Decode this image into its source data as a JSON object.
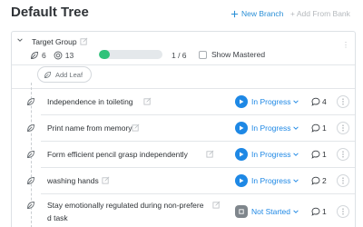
{
  "header": {
    "title": "Default Tree",
    "new_branch_label": "New Branch",
    "add_from_bank_label": "+ Add From Bank"
  },
  "group": {
    "name": "Target Group",
    "leaf_count": "6",
    "target_count": "13",
    "progress_text": "1 / 6",
    "progress_fraction": 0.17,
    "show_mastered_label": "Show Mastered",
    "add_leaf_label": "Add Leaf"
  },
  "leaves": [
    {
      "name": "Independence in toileting",
      "status": "In Progress",
      "comments": "4"
    },
    {
      "name": "Print name from memory",
      "status": "In Progress",
      "comments": "1"
    },
    {
      "name": "Form efficient pencil grasp independently",
      "status": "In Progress",
      "comments": "1"
    },
    {
      "name": "washing hands",
      "status": "In Progress",
      "comments": "2"
    },
    {
      "name_line1": "Stay emotionally regulated during non-prefere",
      "name_line2": "d task",
      "status": "Not Started",
      "comments": "1"
    }
  ],
  "colors": {
    "accent": "#2a8fd6",
    "in_progress": "#1e88e5",
    "not_started": "#7f868c",
    "progress_fill": "#2fc27a"
  },
  "icons": [
    "plus-icon",
    "leaf-icon",
    "target-icon",
    "edit-icon",
    "chevron-down-icon",
    "play-icon",
    "stop-icon",
    "comment-icon",
    "more-icon"
  ]
}
